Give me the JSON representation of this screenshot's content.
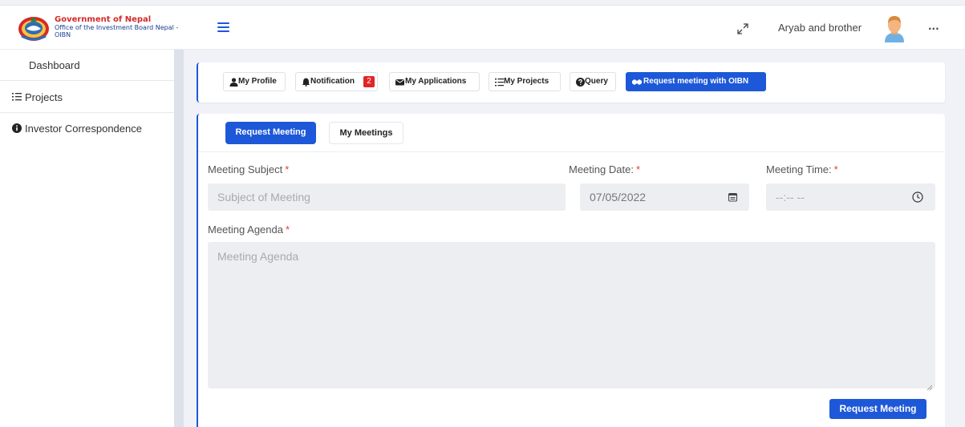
{
  "brand": {
    "line1": "Government of Nepal",
    "line2": "Office of the Investment Board Nepal -",
    "line3": "OIBN",
    "logo_icon": "nepal-emblem-icon"
  },
  "header": {
    "menu_icon": "hamburger-icon",
    "fullscreen_icon": "expand-icon",
    "user_name": "Aryab and brother",
    "more_icon": "more-horizontal-icon",
    "more_text": "···"
  },
  "sidebar": {
    "items": [
      {
        "label": "Dashboard",
        "icon": ""
      },
      {
        "label": "Projects",
        "icon": "list-icon"
      },
      {
        "label": "Investor Correspondence",
        "icon": "info-circle-icon"
      }
    ]
  },
  "nav": {
    "buttons": [
      {
        "label": "My Profile",
        "icon": "user-icon"
      },
      {
        "label": "Notification",
        "icon": "bell-icon",
        "badge": "2"
      },
      {
        "label": "My Applications",
        "icon": "envelope-icon"
      },
      {
        "label": "My Projects",
        "icon": "list-icon"
      },
      {
        "label": "Query",
        "icon": "question-circle-icon"
      },
      {
        "label": "Request meeting with OIBN",
        "icon": "handshake-icon",
        "active": true
      }
    ]
  },
  "tabs": {
    "request": "Request Meeting",
    "my_meetings": "My Meetings"
  },
  "form": {
    "subject_label": "Meeting Subject",
    "subject_placeholder": "Subject of Meeting",
    "date_label": "Meeting Date:",
    "date_value": "07/05/2022",
    "time_label": "Meeting Time:",
    "time_value": "--:-- --",
    "agenda_label": "Meeting Agenda",
    "agenda_placeholder": "Meeting Agenda",
    "required_mark": "*",
    "submit_label": "Request Meeting"
  },
  "colors": {
    "accent": "#1d58d8",
    "badge": "#e02626",
    "required": "#e23c3c",
    "brand_red": "#d42a2a",
    "brand_blue": "#1a3c8f"
  }
}
